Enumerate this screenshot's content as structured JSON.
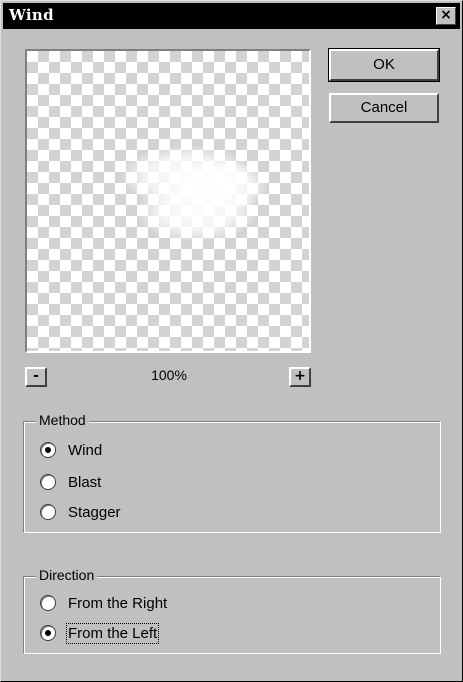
{
  "window": {
    "title": "Wind",
    "close_symbol": "×"
  },
  "buttons": {
    "ok": "OK",
    "cancel": "Cancel"
  },
  "zoom": {
    "minus": "-",
    "plus": "+",
    "level": "100%"
  },
  "method": {
    "legend": "Method",
    "options": [
      {
        "label": "Wind",
        "checked": true
      },
      {
        "label": "Blast",
        "checked": false
      },
      {
        "label": "Stagger",
        "checked": false
      }
    ]
  },
  "direction": {
    "legend": "Direction",
    "options": [
      {
        "label": "From the Right",
        "checked": false
      },
      {
        "label": "From the Left",
        "checked": true
      }
    ]
  },
  "icons": {
    "close": "close-icon"
  }
}
